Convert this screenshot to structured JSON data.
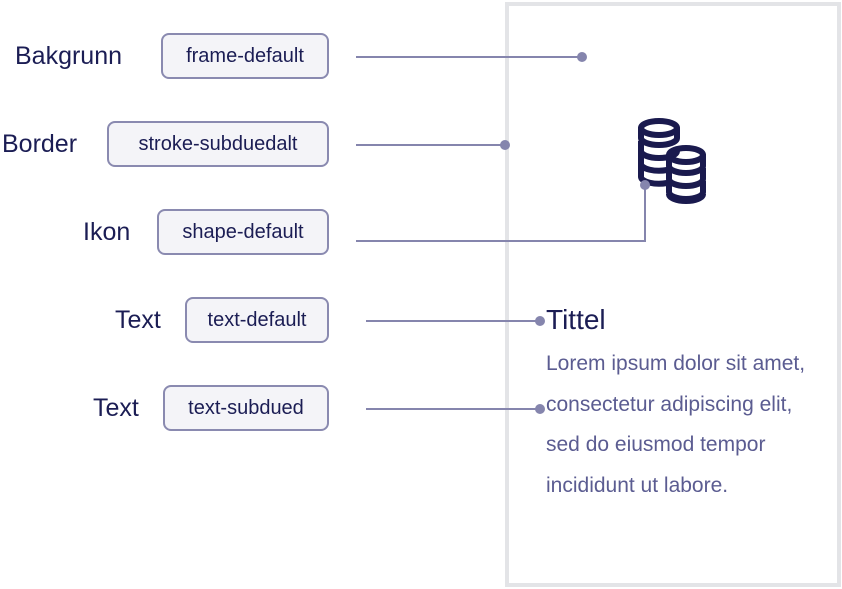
{
  "annotations": [
    {
      "label": "Bakgrunn",
      "token": "frame-default"
    },
    {
      "label": "Border",
      "token": "stroke-subduedalt"
    },
    {
      "label": "Ikon",
      "token": "shape-default"
    },
    {
      "label": "Text",
      "token": "text-default"
    },
    {
      "label": "Text",
      "token": "text-subdued"
    }
  ],
  "card": {
    "icon": "coins-icon",
    "title": "Tittel",
    "body": "Lorem ipsum dolor sit amet, consectetur adipiscing elit, sed do eiusmod tempor incididunt ut labore."
  },
  "colors": {
    "text_default": "#1b1d54",
    "text_subdued": "#5b5c91",
    "connector": "#8585ad",
    "card_border": "#e3e4e7",
    "pill_background": "#f4f4f8"
  }
}
